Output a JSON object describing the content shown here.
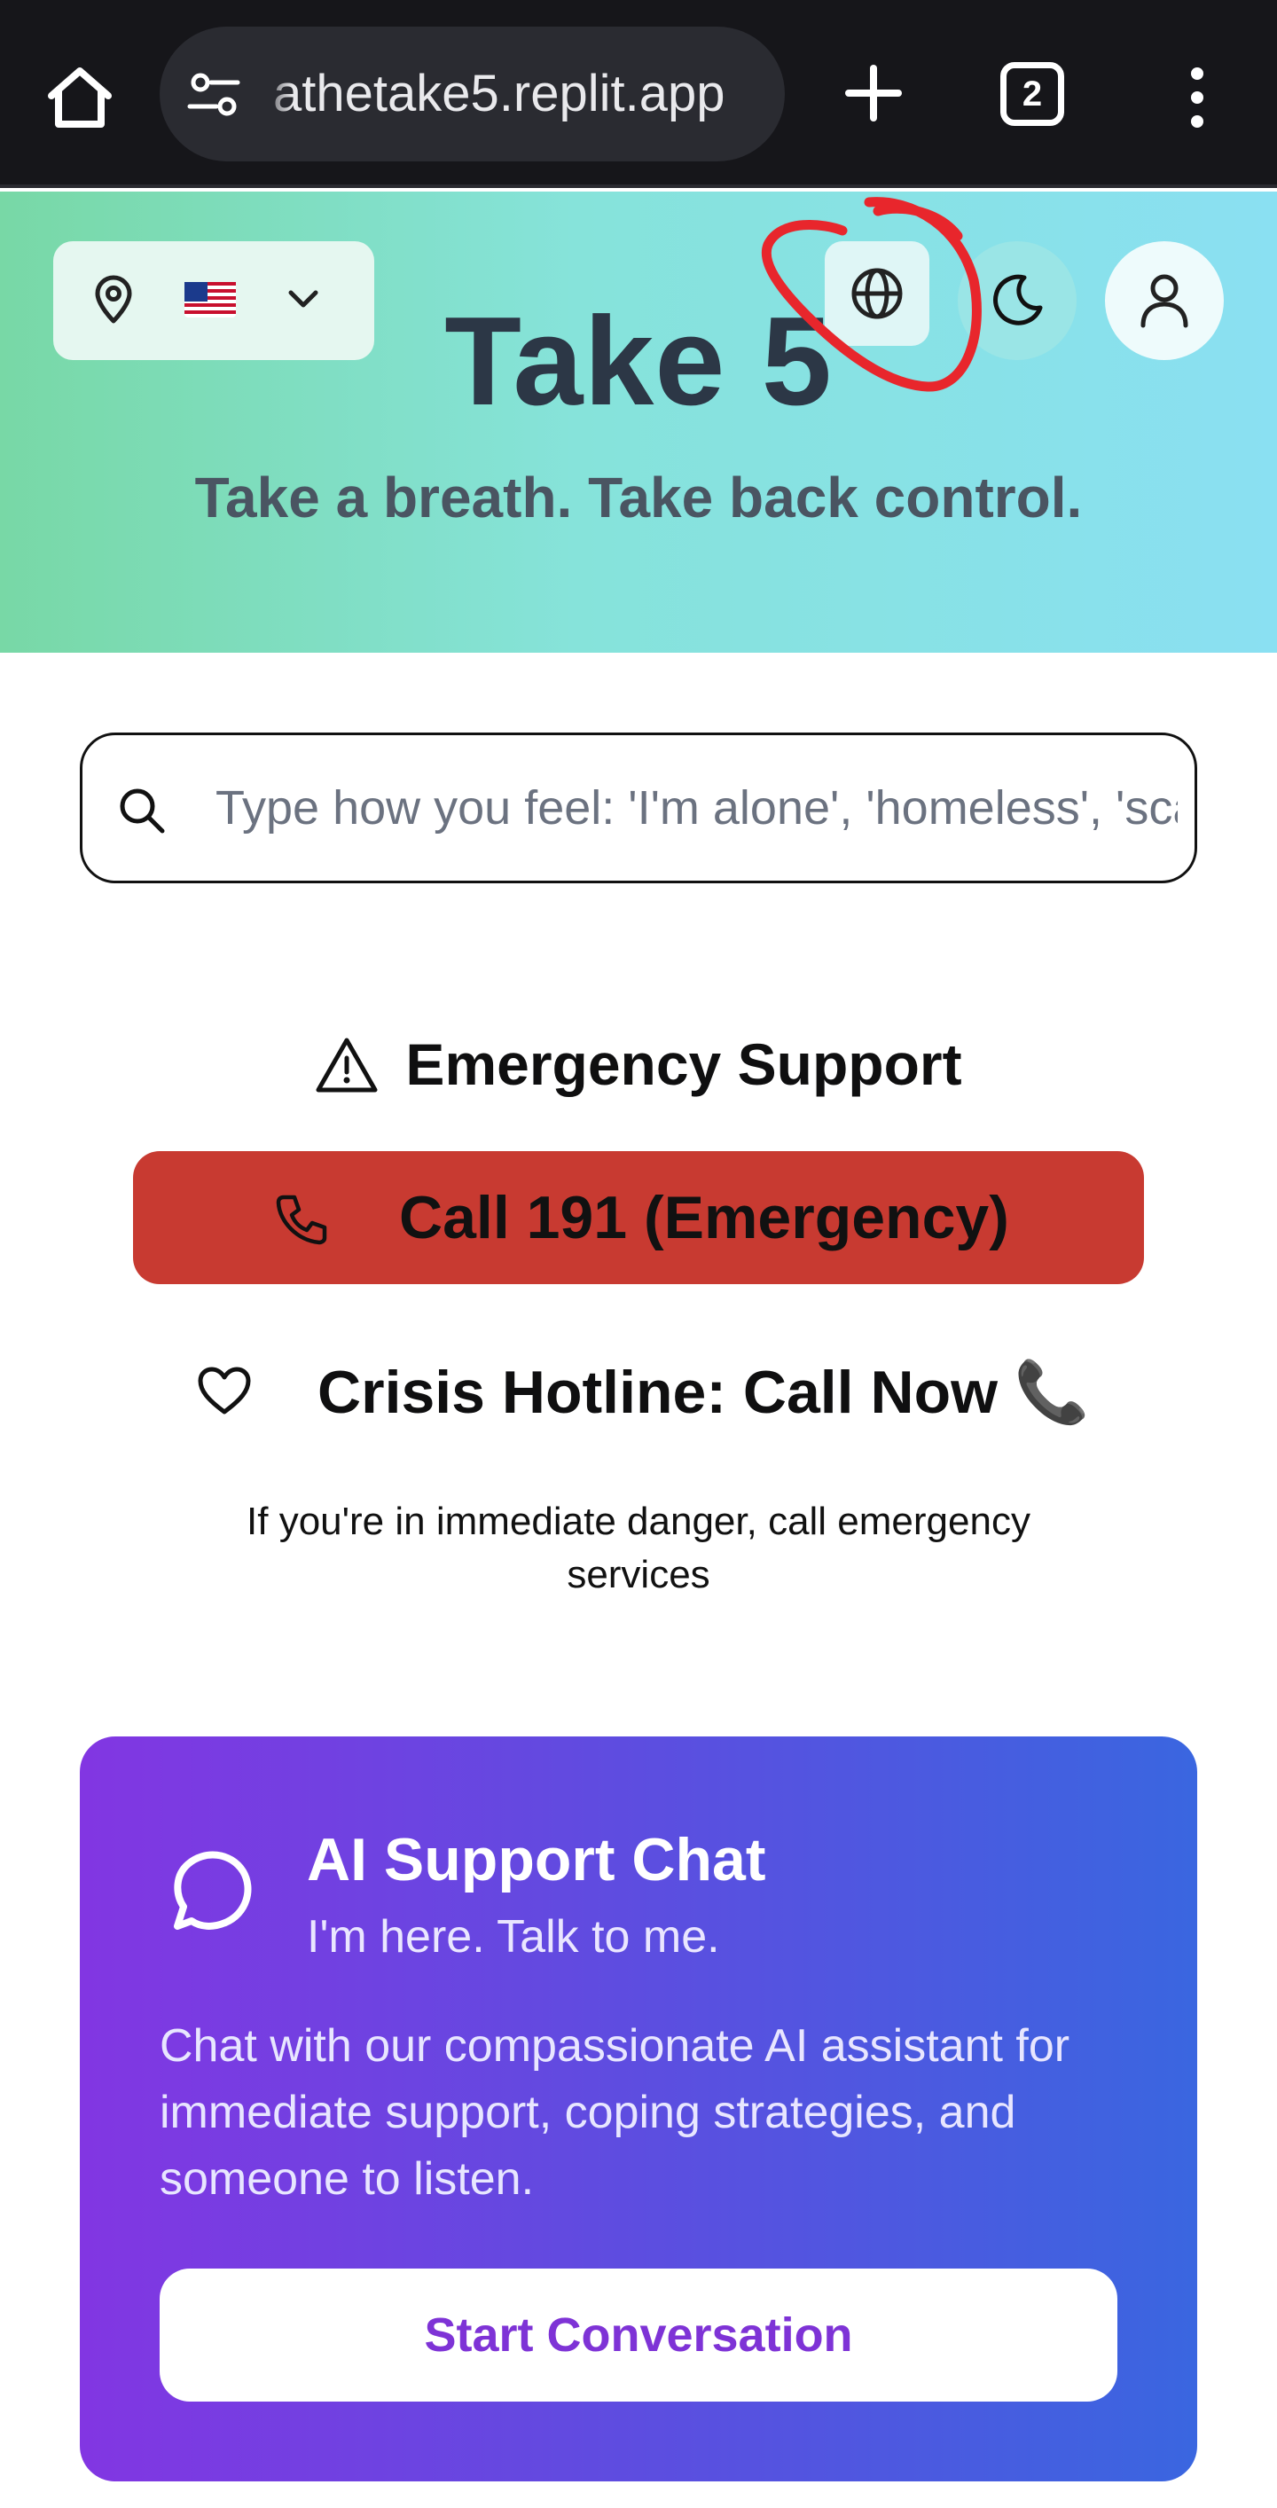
{
  "browser": {
    "url": "athetake5.replit.app",
    "tab_count": "2",
    "icons": [
      "home-icon",
      "site-settings-icon",
      "plus-icon",
      "tabs-icon",
      "more-vertical-icon"
    ]
  },
  "header": {
    "title": "Take 5",
    "tagline": "Take a breath. Take back control.",
    "locale_icons": [
      "map-pin-icon",
      "us-flag-icon",
      "chevron-down-icon"
    ],
    "action_icons": [
      "globe-icon",
      "moon-icon",
      "user-icon"
    ]
  },
  "search": {
    "placeholder": "Type how you feel: 'I'm alone', 'homeless', 'scared'...",
    "value": ""
  },
  "emergency": {
    "heading": "Emergency Support",
    "call_label": "Call 191 (Emergency)",
    "hotline_label": "Crisis Hotline: Call Now 📞",
    "note": "If you're in immediate danger, call emergency services"
  },
  "ai_chat": {
    "title": "AI Support Chat",
    "subtitle": "I'm here. Talk to me.",
    "description": "Chat with our compassionate AI assistant for immediate support, coping strategies, and someone to listen.",
    "button_label": "Start Conversation"
  },
  "colors": {
    "emergency_red": "#c83a31",
    "brand_purple": "#8236e2",
    "brand_blue": "#3a66e0",
    "annotation_red": "#e8262c"
  }
}
